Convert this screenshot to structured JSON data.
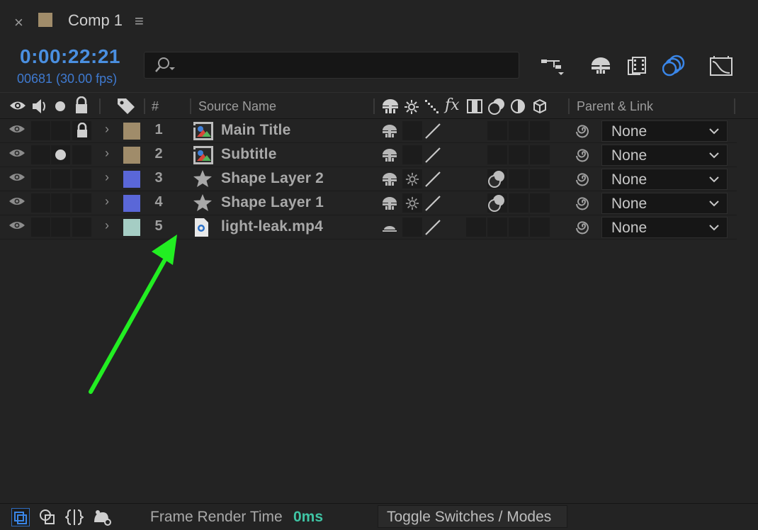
{
  "tab": {
    "close": "×",
    "title": "Comp 1",
    "menu": "≡",
    "swatch_color": "#a08c6a"
  },
  "time": {
    "timecode": "0:00:22:21",
    "frames": "00681 (30.00 fps)"
  },
  "search": {
    "placeholder": "",
    "icon": "search-icon"
  },
  "header": {
    "number": "#",
    "source_name": "Source Name",
    "fx": "fx",
    "parent_link": "Parent & Link"
  },
  "layers": [
    {
      "num": "1",
      "name": "Main Title",
      "color": "#a08c6a",
      "type": "precomp",
      "parent": "None"
    },
    {
      "num": "2",
      "name": "Subtitle",
      "color": "#a08c6a",
      "type": "precomp",
      "parent": "None"
    },
    {
      "num": "3",
      "name": "Shape Layer 2",
      "color": "#5a67d8",
      "type": "shape",
      "parent": "None"
    },
    {
      "num": "4",
      "name": "Shape Layer 1",
      "color": "#5a67d8",
      "type": "shape",
      "parent": "None"
    },
    {
      "num": "5",
      "name": "light-leak.mp4",
      "color": "#a5cdc4",
      "type": "footage",
      "parent": "None"
    }
  ],
  "footer": {
    "frame_render_label": "Frame Render Time",
    "frame_render_value": "0ms",
    "toggle": "Toggle Switches / Modes"
  },
  "colors": {
    "accent_blue": "#4a8fe0",
    "render_green": "#3fc4a4",
    "arrow_green": "#22ee22"
  }
}
